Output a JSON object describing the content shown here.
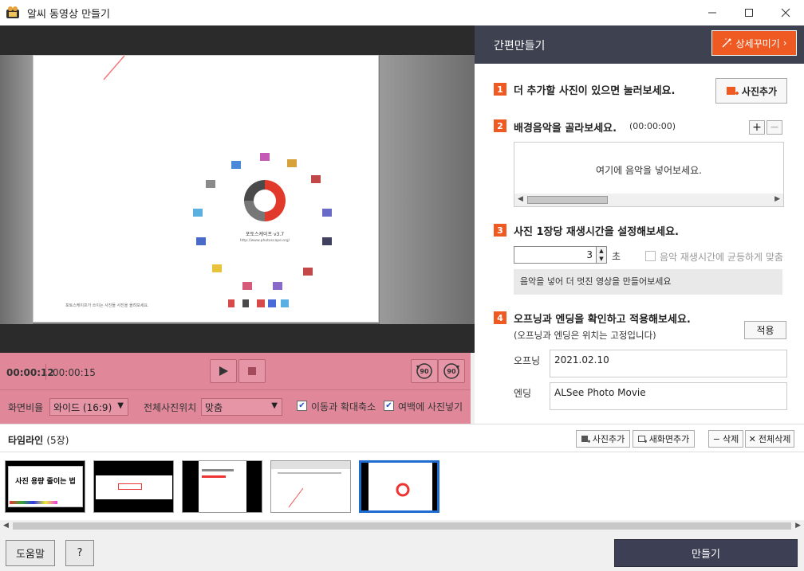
{
  "window": {
    "title": "알씨 동영상 만들기"
  },
  "player": {
    "current_time": "00:00:12",
    "total_time": "00:00:15",
    "aspect_label": "화면비율",
    "aspect_value": "와이드 (16:9)",
    "position_label": "전체사진위치",
    "position_value": "맞춤",
    "move_zoom_label": "이동과 확대축소",
    "move_zoom_checked": true,
    "fill_margin_label": "여백에 사진넣기",
    "fill_margin_checked": true,
    "rotate_left_label": "90",
    "rotate_right_label": "90"
  },
  "right_panel": {
    "title": "간편만들기",
    "detail_button": "상세꾸미기",
    "step1": {
      "num": "1",
      "text": "더 추가할 사진이 있으면 눌러보세요.",
      "button": "사진추가"
    },
    "step2": {
      "num": "2",
      "text": "배경음악을 골라보세요.",
      "duration": "(00:00:00)",
      "placeholder": "여기에 음악을 넣어보세요."
    },
    "step3": {
      "num": "3",
      "text": "사진 1장당 재생시간을 설정해보세요.",
      "seconds_value": "3",
      "seconds_unit": "초",
      "sync_label": "음악 재생시간에 균등하게 맞춤",
      "info": "음악을 넣어 더 멋진 영상을 만들어보세요"
    },
    "step4": {
      "num": "4",
      "text": "오프닝과 엔딩을 확인하고 적용해보세요.",
      "note": "(오프닝과 엔딩은 위치는 고정입니다)",
      "apply_button": "적용",
      "opening_label": "오프닝",
      "opening_value": "2021.02.10",
      "ending_label": "엔딩",
      "ending_value": "ALSee Photo Movie"
    }
  },
  "timeline": {
    "title": "타임라인",
    "count": "(5장)",
    "add_photo": "사진추가",
    "add_screen": "새화면추가",
    "delete": "삭제",
    "delete_all": "전체삭제",
    "thumb1_text": "사진 용량 줄이는 법"
  },
  "preview": {
    "app_name": "포토스케이프 v3.7",
    "app_url": "http://www.photoscape.org/",
    "footer": "포토스케이프가 쓰이는 사진들 사진을 올려보세요."
  },
  "bottom": {
    "help": "도움말",
    "question": "?",
    "make": "만들기"
  },
  "colors": {
    "accent": "#ee5a22",
    "dark": "#3e4150",
    "control_bg": "#e0889a",
    "selection": "#1e6ccf"
  }
}
